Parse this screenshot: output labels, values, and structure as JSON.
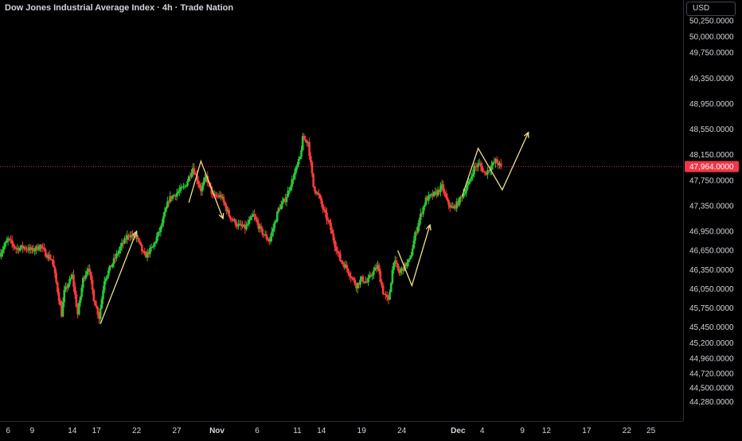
{
  "header": {
    "title": "Dow Jones Industrial Average Index · 4h · Trade Nation",
    "currency": "USD"
  },
  "colors": {
    "background": "#000000",
    "up": "#26c936",
    "down": "#ff3b3b",
    "drawing": "#f0e08a",
    "last_price_tag": "#f23645",
    "axis_text": "#d1d4dc"
  },
  "chart_data": {
    "type": "candlestick",
    "title": "Dow Jones Industrial Average Index · 4h · Trade Nation",
    "grid": false,
    "legend": "none",
    "y_axis": {
      "position": "right",
      "ylim": [
        44100,
        50450
      ],
      "ticks": [
        {
          "v": 50250,
          "label": "50,250.0000"
        },
        {
          "v": 50000,
          "label": "50,000.0000"
        },
        {
          "v": 49750,
          "label": "49,750.0000"
        },
        {
          "v": 49350,
          "label": "49,350.0000"
        },
        {
          "v": 48950,
          "label": "48,950.0000"
        },
        {
          "v": 48550,
          "label": "48,550.0000"
        },
        {
          "v": 48150,
          "label": "48,150.0000"
        },
        {
          "v": 47750,
          "label": "47,750.0000"
        },
        {
          "v": 47350,
          "label": "47,350.0000"
        },
        {
          "v": 46950,
          "label": "46,950.0000"
        },
        {
          "v": 46650,
          "label": "46,650.0000"
        },
        {
          "v": 46350,
          "label": "46,350.0000"
        },
        {
          "v": 46050,
          "label": "46,050.0000"
        },
        {
          "v": 45750,
          "label": "45,750.0000"
        },
        {
          "v": 45450,
          "label": "45,450.0000"
        },
        {
          "v": 45200,
          "label": "45,200.0000"
        },
        {
          "v": 44960,
          "label": "44,960.0000"
        },
        {
          "v": 44720,
          "label": "44,720.0000"
        },
        {
          "v": 44500,
          "label": "44,500.0000"
        },
        {
          "v": 44280,
          "label": "44,280.0000"
        }
      ]
    },
    "last_price": {
      "value": 47964,
      "label": "47,964.0000"
    },
    "x_axis": {
      "start_date": "2025-10-05",
      "end_date": "2025-12-29",
      "ticks": [
        {
          "date": "2025-10-06",
          "label": "6",
          "bold": false
        },
        {
          "date": "2025-10-09",
          "label": "9",
          "bold": false
        },
        {
          "date": "2025-10-14",
          "label": "14",
          "bold": false
        },
        {
          "date": "2025-10-17",
          "label": "17",
          "bold": false
        },
        {
          "date": "2025-10-22",
          "label": "22",
          "bold": false
        },
        {
          "date": "2025-10-27",
          "label": "27",
          "bold": false
        },
        {
          "date": "2025-11-01",
          "label": "Nov",
          "bold": true
        },
        {
          "date": "2025-11-06",
          "label": "6",
          "bold": false
        },
        {
          "date": "2025-11-11",
          "label": "11",
          "bold": false
        },
        {
          "date": "2025-11-14",
          "label": "14",
          "bold": false
        },
        {
          "date": "2025-11-19",
          "label": "19",
          "bold": false
        },
        {
          "date": "2025-11-24",
          "label": "24",
          "bold": false
        },
        {
          "date": "2025-12-01",
          "label": "Dec",
          "bold": true
        },
        {
          "date": "2025-12-04",
          "label": "4",
          "bold": false
        },
        {
          "date": "2025-12-09",
          "label": "9",
          "bold": false
        },
        {
          "date": "2025-12-12",
          "label": "12",
          "bold": false
        },
        {
          "date": "2025-12-17",
          "label": "17",
          "bold": false
        },
        {
          "date": "2025-12-22",
          "label": "22",
          "bold": false
        },
        {
          "date": "2025-12-25",
          "label": "25",
          "bold": false
        }
      ]
    },
    "price_path": [
      {
        "date": "2025-10-05T00:00",
        "close": 46600
      },
      {
        "date": "2025-10-06T00:00",
        "close": 46820
      },
      {
        "date": "2025-10-07T00:00",
        "close": 46680
      },
      {
        "date": "2025-10-08T00:00",
        "close": 46700
      },
      {
        "date": "2025-10-09T00:00",
        "close": 46650
      },
      {
        "date": "2025-10-10T00:00",
        "close": 46720
      },
      {
        "date": "2025-10-10T16:00",
        "close": 46600
      },
      {
        "date": "2025-10-11T12:00",
        "close": 46500
      },
      {
        "date": "2025-10-12T08:00",
        "close": 45900
      },
      {
        "date": "2025-10-12T16:00",
        "close": 45650
      },
      {
        "date": "2025-10-13T00:00",
        "close": 46000
      },
      {
        "date": "2025-10-14T00:00",
        "close": 46250
      },
      {
        "date": "2025-10-14T16:00",
        "close": 45650
      },
      {
        "date": "2025-10-15T08:00",
        "close": 46200
      },
      {
        "date": "2025-10-16T00:00",
        "close": 46400
      },
      {
        "date": "2025-10-16T16:00",
        "close": 45900
      },
      {
        "date": "2025-10-17T08:00",
        "close": 45600
      },
      {
        "date": "2025-10-18T00:00",
        "close": 46200
      },
      {
        "date": "2025-10-19T00:00",
        "close": 46450
      },
      {
        "date": "2025-10-20T00:00",
        "close": 46700
      },
      {
        "date": "2025-10-21T00:00",
        "close": 46900
      },
      {
        "date": "2025-10-22T00:00",
        "close": 46850
      },
      {
        "date": "2025-10-23T00:00",
        "close": 46550
      },
      {
        "date": "2025-10-24T00:00",
        "close": 46700
      },
      {
        "date": "2025-10-25T00:00",
        "close": 47000
      },
      {
        "date": "2025-10-26T00:00",
        "close": 47450
      },
      {
        "date": "2025-10-27T00:00",
        "close": 47550
      },
      {
        "date": "2025-10-28T00:00",
        "close": 47650
      },
      {
        "date": "2025-10-29T00:00",
        "close": 47950
      },
      {
        "date": "2025-10-30T00:00",
        "close": 47600
      },
      {
        "date": "2025-10-30T16:00",
        "close": 47800
      },
      {
        "date": "2025-10-31T12:00",
        "close": 47500
      },
      {
        "date": "2025-11-01T12:00",
        "close": 47500
      },
      {
        "date": "2025-11-02T12:00",
        "close": 47200
      },
      {
        "date": "2025-11-03T12:00",
        "close": 47050
      },
      {
        "date": "2025-11-04T12:00",
        "close": 47000
      },
      {
        "date": "2025-11-05T12:00",
        "close": 47200
      },
      {
        "date": "2025-11-06T12:00",
        "close": 46950
      },
      {
        "date": "2025-11-07T12:00",
        "close": 46800
      },
      {
        "date": "2025-11-08T00:00",
        "close": 47000
      },
      {
        "date": "2025-11-08T16:00",
        "close": 47300
      },
      {
        "date": "2025-11-09T12:00",
        "close": 47450
      },
      {
        "date": "2025-11-10T12:00",
        "close": 47800
      },
      {
        "date": "2025-11-11T08:00",
        "close": 48100
      },
      {
        "date": "2025-11-11T16:00",
        "close": 48400
      },
      {
        "date": "2025-11-12T08:00",
        "close": 48350
      },
      {
        "date": "2025-11-12T16:00",
        "close": 48000
      },
      {
        "date": "2025-11-13T00:00",
        "close": 47650
      },
      {
        "date": "2025-11-13T16:00",
        "close": 47500
      },
      {
        "date": "2025-11-14T08:00",
        "close": 47250
      },
      {
        "date": "2025-11-15T00:00",
        "close": 47050
      },
      {
        "date": "2025-11-15T16:00",
        "close": 46750
      },
      {
        "date": "2025-11-16T08:00",
        "close": 46500
      },
      {
        "date": "2025-11-17T00:00",
        "close": 46400
      },
      {
        "date": "2025-11-17T16:00",
        "close": 46250
      },
      {
        "date": "2025-11-18T08:00",
        "close": 46100
      },
      {
        "date": "2025-11-19T00:00",
        "close": 46200
      },
      {
        "date": "2025-11-19T16:00",
        "close": 46150
      },
      {
        "date": "2025-11-20T08:00",
        "close": 46300
      },
      {
        "date": "2025-11-21T00:00",
        "close": 46400
      },
      {
        "date": "2025-11-21T16:00",
        "close": 46000
      },
      {
        "date": "2025-11-22T08:00",
        "close": 45850
      },
      {
        "date": "2025-11-23T00:00",
        "close": 46500
      },
      {
        "date": "2025-11-23T16:00",
        "close": 46300
      },
      {
        "date": "2025-11-24T08:00",
        "close": 46400
      },
      {
        "date": "2025-11-25T00:00",
        "close": 46500
      },
      {
        "date": "2025-11-25T16:00",
        "close": 46900
      },
      {
        "date": "2025-11-26T08:00",
        "close": 47200
      },
      {
        "date": "2025-11-27T00:00",
        "close": 47450
      },
      {
        "date": "2025-11-27T16:00",
        "close": 47500
      },
      {
        "date": "2025-11-28T08:00",
        "close": 47550
      },
      {
        "date": "2025-11-29T00:00",
        "close": 47650
      },
      {
        "date": "2025-11-29T16:00",
        "close": 47400
      },
      {
        "date": "2025-11-30T08:00",
        "close": 47300
      },
      {
        "date": "2025-12-01T00:00",
        "close": 47400
      },
      {
        "date": "2025-12-01T16:00",
        "close": 47550
      },
      {
        "date": "2025-12-02T08:00",
        "close": 47700
      },
      {
        "date": "2025-12-03T00:00",
        "close": 47950
      },
      {
        "date": "2025-12-03T16:00",
        "close": 48000
      },
      {
        "date": "2025-12-04T08:00",
        "close": 47850
      },
      {
        "date": "2025-12-05T00:00",
        "close": 47950
      },
      {
        "date": "2025-12-05T16:00",
        "close": 48050
      },
      {
        "date": "2025-12-06T08:00",
        "close": 47964
      }
    ],
    "annotations": [
      {
        "type": "arrow",
        "points": [
          {
            "date": "2025-10-17T12:00",
            "price": 45500
          },
          {
            "date": "2025-10-22T00:00",
            "price": 46950
          }
        ]
      },
      {
        "type": "zigzag-arrow",
        "points": [
          {
            "date": "2025-10-28T12:00",
            "price": 47400
          },
          {
            "date": "2025-10-30T00:00",
            "price": 48050
          },
          {
            "date": "2025-11-01T18:00",
            "price": 47150
          }
        ]
      },
      {
        "type": "zigzag-arrow",
        "points": [
          {
            "date": "2025-11-23T12:00",
            "price": 46650
          },
          {
            "date": "2025-11-25T06:00",
            "price": 46100
          },
          {
            "date": "2025-11-27T12:00",
            "price": 47050
          }
        ]
      },
      {
        "type": "zigzag-arrow",
        "points": [
          {
            "date": "2025-12-01T12:00",
            "price": 47500
          },
          {
            "date": "2025-12-03T12:00",
            "price": 48250
          },
          {
            "date": "2025-12-06T12:00",
            "price": 47600
          },
          {
            "date": "2025-12-09T18:00",
            "price": 48500
          }
        ]
      }
    ]
  }
}
